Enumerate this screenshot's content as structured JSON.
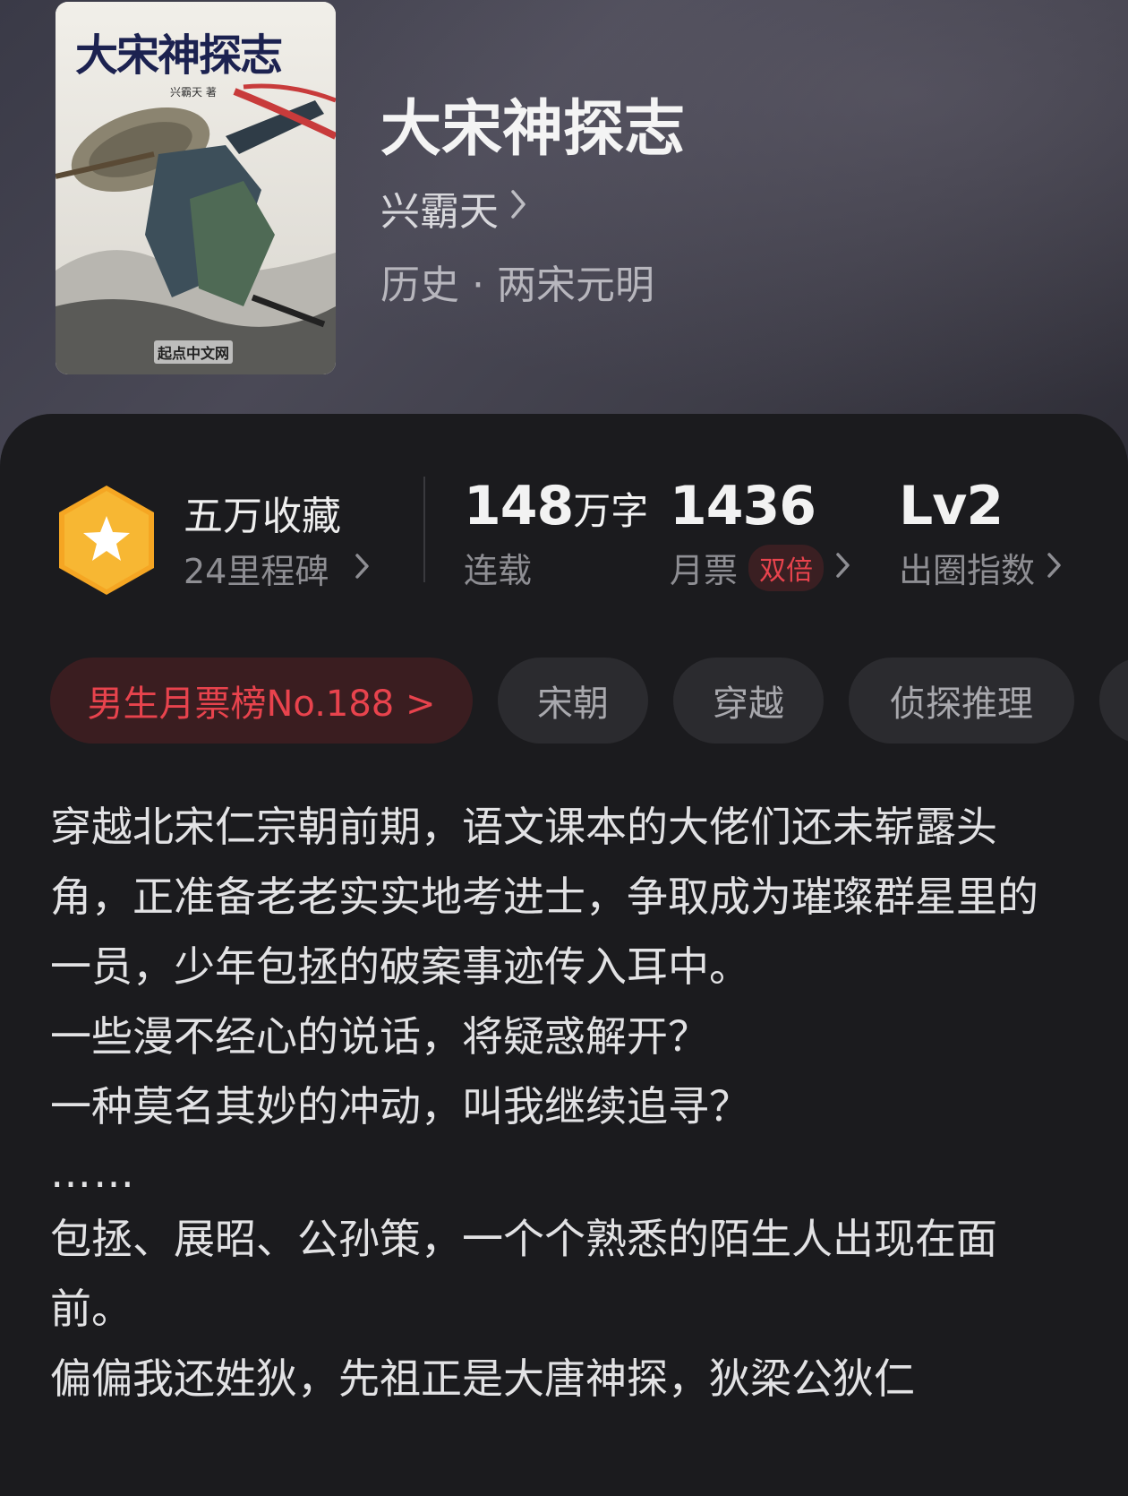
{
  "book": {
    "title": "大宋神探志",
    "author": "兴霸天",
    "category": "历史 · 两宋元明",
    "cover": {
      "title": "大宋神探志",
      "author_line": "兴霸天 著",
      "publisher_logo": "起点中文网"
    }
  },
  "stats": {
    "collection_title": "五万收藏",
    "collection_sub": "24里程碑",
    "word_count_number": "148",
    "word_count_unit": "万字",
    "word_count_label": "连载",
    "monthly_ticket_number": "1436",
    "monthly_ticket_label": "月票",
    "monthly_ticket_badge": "双倍",
    "influence_number": "Lv2",
    "influence_label": "出圈指数"
  },
  "tags": {
    "rank": "男生月票榜No.188 >",
    "items": [
      "宋朝",
      "穿越",
      "侦探推理"
    ]
  },
  "description": {
    "paragraphs": [
      "穿越北宋仁宗朝前期，语文课本的大佬们还未崭露头角，正准备老老实实地考进士，争取成为璀璨群星里的一员，少年包拯的破案事迹传入耳中。",
      "一些漫不经心的说话，将疑惑解开？",
      "一种莫名其妙的冲动，叫我继续追寻？",
      "……",
      "包拯、展昭、公孙策，一个个熟悉的陌生人出现在面前。",
      "偏偏我还姓狄，先祖正是大唐神探，狄梁公狄仁"
    ]
  },
  "colors": {
    "accent_red": "#e8434d",
    "badge_orange": "#f5a623",
    "background": "#1b1b1e"
  },
  "icons": {
    "badge": "star-hexagon-icon",
    "chevron": "chevron-right-icon"
  }
}
